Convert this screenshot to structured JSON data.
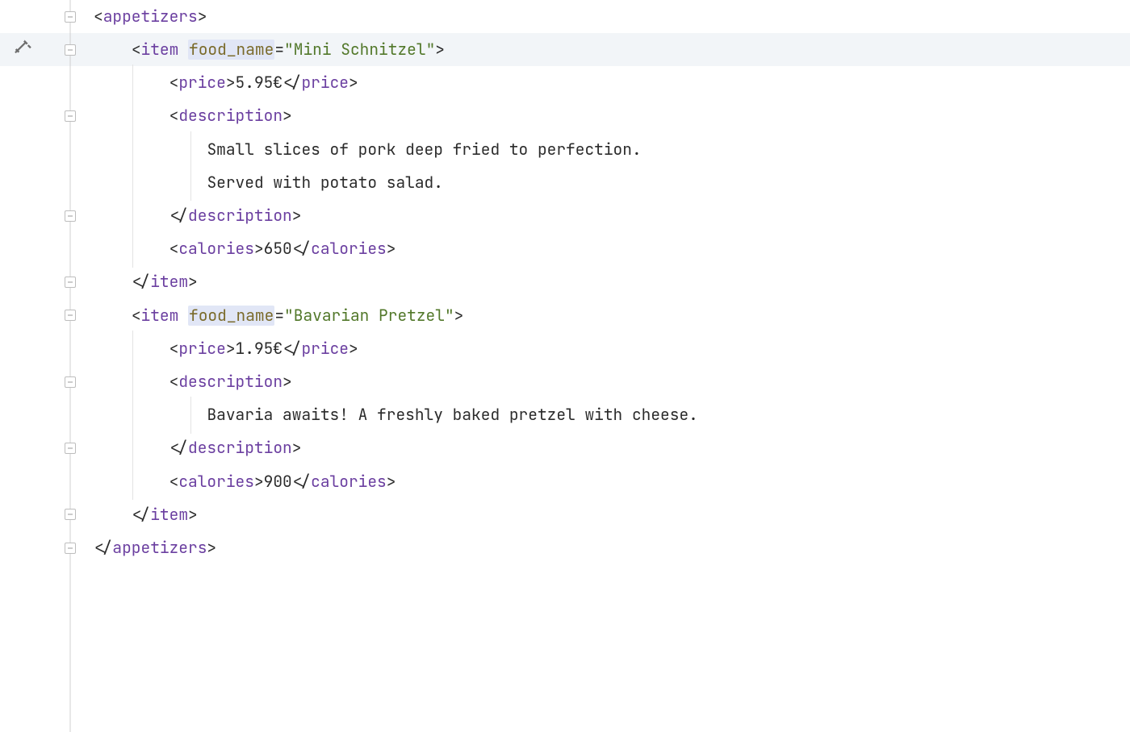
{
  "colors": {
    "tag": "#6b3fa0",
    "attr": "#7a6a2a",
    "attrval": "#52782a",
    "text": "#2b2b2b"
  },
  "xml": {
    "root": "appetizers",
    "itemTag": "item",
    "attrName": "food_name",
    "childTags": {
      "price": "price",
      "description": "description",
      "calories": "calories"
    },
    "items": [
      {
        "food_name": "Mini Schnitzel",
        "price": "5.95€",
        "descriptionLines": [
          "Small slices of pork deep fried to perfection.",
          "Served with potato salad."
        ],
        "calories": "650"
      },
      {
        "food_name": "Bavarian Pretzel",
        "price": "1.95€",
        "descriptionLines": [
          "Bavaria awaits! A freshly baked pretzel with cheese."
        ],
        "calories": "900"
      }
    ]
  }
}
